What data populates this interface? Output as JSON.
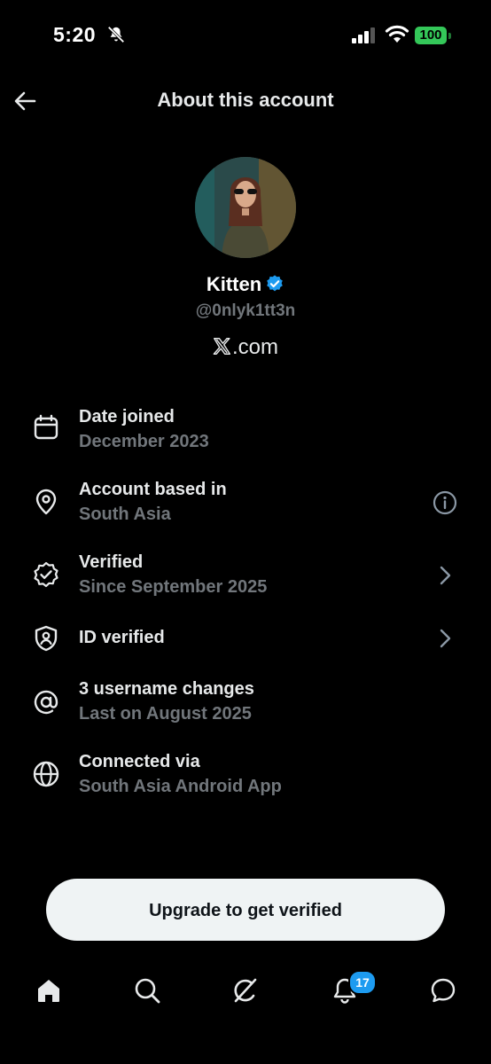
{
  "status_bar": {
    "time": "5:20",
    "battery": "100"
  },
  "header": {
    "title": "About this account"
  },
  "profile": {
    "display_name": "Kitten",
    "handle": "@0nlyk1tt3n",
    "site": ".com"
  },
  "details": [
    {
      "icon": "calendar-icon",
      "title": "Date joined",
      "subtitle": "December 2023"
    },
    {
      "icon": "location-pin-icon",
      "title": "Account based in",
      "subtitle": "South Asia"
    },
    {
      "icon": "verified-badge-icon",
      "title": "Verified",
      "subtitle": "Since September 2025"
    },
    {
      "icon": "id-shield-icon",
      "title": "ID verified",
      "subtitle": ""
    },
    {
      "icon": "at-sign-icon",
      "title": "3 username changes",
      "subtitle": "Last on August 2025"
    },
    {
      "icon": "globe-icon",
      "title": "Connected via",
      "subtitle": "South Asia Android App"
    }
  ],
  "upgrade_button": {
    "label": "Upgrade to get verified"
  },
  "bottom_nav": {
    "items": [
      "home-icon",
      "search-icon",
      "grok-icon",
      "notifications-icon",
      "messages-icon"
    ],
    "notification_count": "17"
  },
  "colors": {
    "accent": "#1d9bf0",
    "background": "#000000",
    "muted": "#71767b",
    "battery": "#34c759"
  }
}
